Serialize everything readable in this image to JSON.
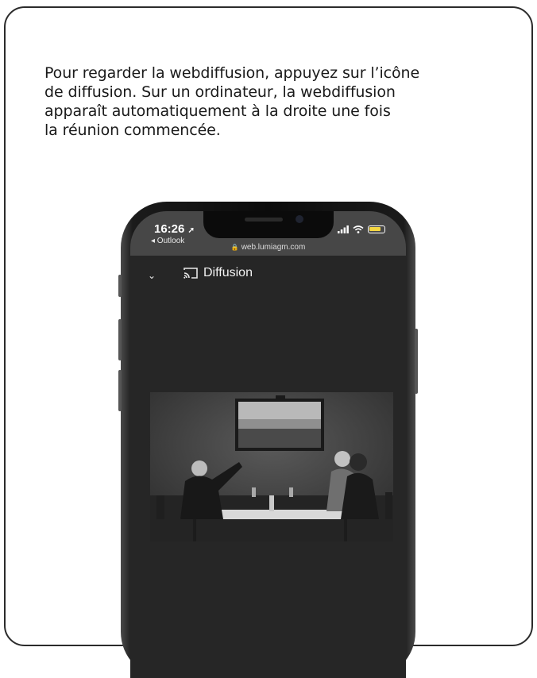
{
  "instructions": {
    "lines": [
      "Pour regarder la webdiffusion, appuyez sur l’icône",
      "de diffusion. Sur un ordinateur, la webdiffusion",
      "apparaît automatiquement à la droite une fois",
      "la réunion commencée."
    ]
  },
  "phone": {
    "status_bar": {
      "time": "16:26",
      "back_app": "◂ Outlook",
      "url": "web.lumiagm.com"
    },
    "app_header": {
      "title": "Diffusion"
    }
  },
  "icons": {
    "location": "location-arrow-icon",
    "signal": "signal-icon",
    "wifi": "wifi-icon",
    "battery": "battery-icon",
    "lock": "lock-icon",
    "collapse": "chevron-down-icon",
    "cast": "cast-icon"
  }
}
